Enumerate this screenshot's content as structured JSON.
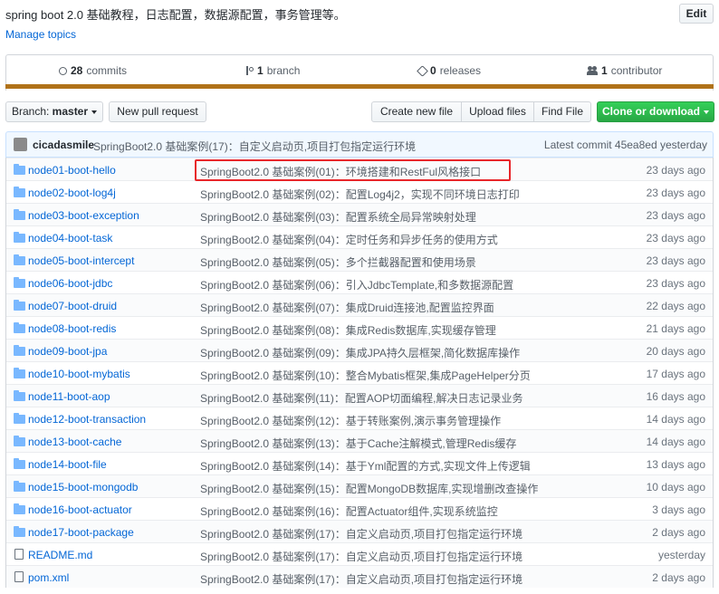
{
  "repo": {
    "description": "spring boot 2.0 基础教程，日志配置，数据源配置，事务管理等。",
    "edit_label": "Edit",
    "manage_topics_label": "Manage topics"
  },
  "numbers": {
    "commits_count": "28",
    "commits_label": "commits",
    "branch_count": "1",
    "branch_label": "branch",
    "releases_count": "0",
    "releases_label": "releases",
    "contributor_count": "1",
    "contributor_label": "contributor"
  },
  "toolbar": {
    "branch_prefix": "Branch:",
    "branch_name": "master",
    "new_pull_request": "New pull request",
    "create_new_file": "Create new file",
    "upload_files": "Upload files",
    "find_file": "Find File",
    "clone_or_download": "Clone or download"
  },
  "latest_commit": {
    "author": "cicadasmile",
    "message": "SpringBoot2.0 基础案例(17)：自定义启动页,项目打包指定运行环境",
    "label": "Latest commit 45ea8ed yesterday"
  },
  "files": [
    {
      "type": "dir",
      "name": "node01-boot-hello",
      "message": "SpringBoot2.0 基础案例(01)：环境搭建和RestFul风格接口",
      "age": "23 days ago"
    },
    {
      "type": "dir",
      "name": "node02-boot-log4j",
      "message": "SpringBoot2.0 基础案例(02)：配置Log4j2，实现不同环境日志打印",
      "age": "23 days ago"
    },
    {
      "type": "dir",
      "name": "node03-boot-exception",
      "message": "SpringBoot2.0 基础案例(03)：配置系统全局异常映射处理",
      "age": "23 days ago"
    },
    {
      "type": "dir",
      "name": "node04-boot-task",
      "message": "SpringBoot2.0 基础案例(04)：定时任务和异步任务的使用方式",
      "age": "23 days ago"
    },
    {
      "type": "dir",
      "name": "node05-boot-intercept",
      "message": "SpringBoot2.0 基础案例(05)：多个拦截器配置和使用场景",
      "age": "23 days ago"
    },
    {
      "type": "dir",
      "name": "node06-boot-jdbc",
      "message": "SpringBoot2.0 基础案例(06)：引入JdbcTemplate,和多数据源配置",
      "age": "23 days ago"
    },
    {
      "type": "dir",
      "name": "node07-boot-druid",
      "message": "SpringBoot2.0 基础案例(07)：集成Druid连接池,配置监控界面",
      "age": "22 days ago"
    },
    {
      "type": "dir",
      "name": "node08-boot-redis",
      "message": "SpringBoot2.0 基础案例(08)：集成Redis数据库,实现缓存管理",
      "age": "21 days ago"
    },
    {
      "type": "dir",
      "name": "node09-boot-jpa",
      "message": "SpringBoot2.0 基础案例(09)：集成JPA持久层框架,简化数据库操作",
      "age": "20 days ago"
    },
    {
      "type": "dir",
      "name": "node10-boot-mybatis",
      "message": "SpringBoot2.0 基础案例(10)：整合Mybatis框架,集成PageHelper分页",
      "age": "17 days ago"
    },
    {
      "type": "dir",
      "name": "node11-boot-aop",
      "message": "SpringBoot2.0 基础案例(11)：配置AOP切面编程,解决日志记录业务",
      "age": "16 days ago"
    },
    {
      "type": "dir",
      "name": "node12-boot-transaction",
      "message": "SpringBoot2.0 基础案例(12)：基于转账案例,演示事务管理操作",
      "age": "14 days ago"
    },
    {
      "type": "dir",
      "name": "node13-boot-cache",
      "message": "SpringBoot2.0 基础案例(13)：基于Cache注解模式,管理Redis缓存",
      "age": "14 days ago"
    },
    {
      "type": "dir",
      "name": "node14-boot-file",
      "message": "SpringBoot2.0 基础案例(14)：基于Yml配置的方式,实现文件上传逻辑",
      "age": "13 days ago"
    },
    {
      "type": "dir",
      "name": "node15-boot-mongodb",
      "message": "SpringBoot2.0 基础案例(15)：配置MongoDB数据库,实现增删改查操作",
      "age": "10 days ago"
    },
    {
      "type": "dir",
      "name": "node16-boot-actuator",
      "message": "SpringBoot2.0 基础案例(16)：配置Actuator组件,实现系统监控",
      "age": "3 days ago"
    },
    {
      "type": "dir",
      "name": "node17-boot-package",
      "message": "SpringBoot2.0 基础案例(17)：自定义启动页,项目打包指定运行环境",
      "age": "2 days ago"
    },
    {
      "type": "file",
      "name": "README.md",
      "message": "SpringBoot2.0 基础案例(17)：自定义启动页,项目打包指定运行环境",
      "age": "yesterday"
    },
    {
      "type": "file",
      "name": "pom.xml",
      "message": "SpringBoot2.0 基础案例(17)：自定义启动页,项目打包指定运行环境",
      "age": "2 days ago"
    }
  ],
  "colors": {
    "link": "#0366d6",
    "language_bar": "#b07219",
    "highlight_box": "#e8262a",
    "clone_button": "#28a745"
  }
}
